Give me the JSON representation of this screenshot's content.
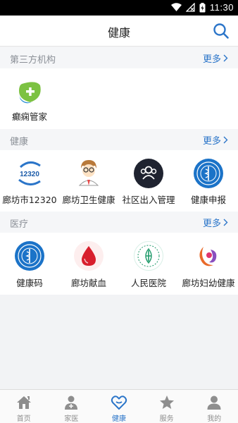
{
  "status_bar": {
    "time": "11:30"
  },
  "header": {
    "title": "健康"
  },
  "sections": [
    {
      "title": "第三方机构",
      "more": "更多",
      "items": [
        {
          "label": "癫痫管家",
          "icon": "epilepsy-manager-icon"
        }
      ]
    },
    {
      "title": "健康",
      "more": "更多",
      "items": [
        {
          "label": "廊坊市12320",
          "icon": "hotline-12320-icon"
        },
        {
          "label": "廊坊卫生健康",
          "icon": "doctor-avatar-icon"
        },
        {
          "label": "社区出入管理",
          "icon": "community-people-icon"
        },
        {
          "label": "健康申报",
          "icon": "health-emblem-icon"
        }
      ]
    },
    {
      "title": "医疗",
      "more": "更多",
      "items": [
        {
          "label": "健康码",
          "icon": "health-code-emblem-icon"
        },
        {
          "label": "廊坊献血",
          "icon": "blood-drop-icon"
        },
        {
          "label": "人民医院",
          "icon": "hospital-logo-icon"
        },
        {
          "label": "廊坊妇幼健康",
          "icon": "maternal-child-icon"
        }
      ]
    }
  ],
  "tabbar": {
    "tabs": [
      {
        "label": "首页",
        "icon": "home-icon"
      },
      {
        "label": "家医",
        "icon": "family-doctor-icon"
      },
      {
        "label": "健康",
        "icon": "heart-icon",
        "active": true
      },
      {
        "label": "服务",
        "icon": "star-icon"
      },
      {
        "label": "我的",
        "icon": "user-icon"
      }
    ]
  },
  "colors": {
    "accent": "#2b75c9",
    "section_bg": "#f5f6f8",
    "muted_text": "#8a8f96"
  }
}
